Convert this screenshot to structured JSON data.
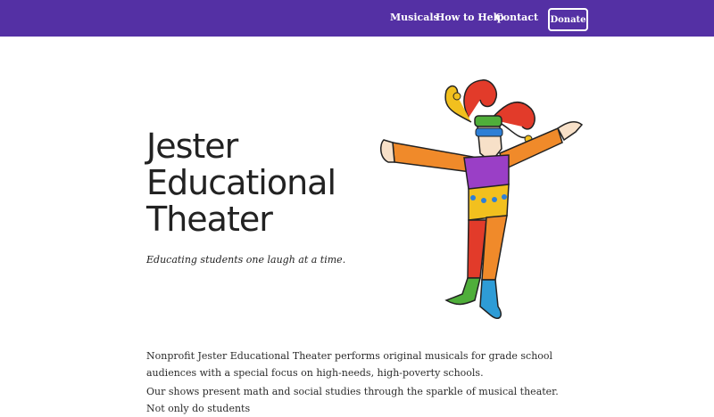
{
  "nav": {
    "items": [
      "Musicals",
      "How to Help",
      "Contact"
    ],
    "donate_label": "Donate"
  },
  "hero": {
    "title": "Jester Educational Theater",
    "tagline": "Educating students one laugh at a time."
  },
  "content": {
    "paragraph1": "Nonprofit Jester Educational Theater performs original musicals for grade school audiences with a special focus on high-needs, high-poverty schools.",
    "paragraph2": "Our shows present math and social studies through the sparkle of musical theater. Not only do students"
  },
  "colors": {
    "header": "#5430a4",
    "text": "#222222"
  },
  "icons": {
    "illustration": "jester-illustration"
  }
}
